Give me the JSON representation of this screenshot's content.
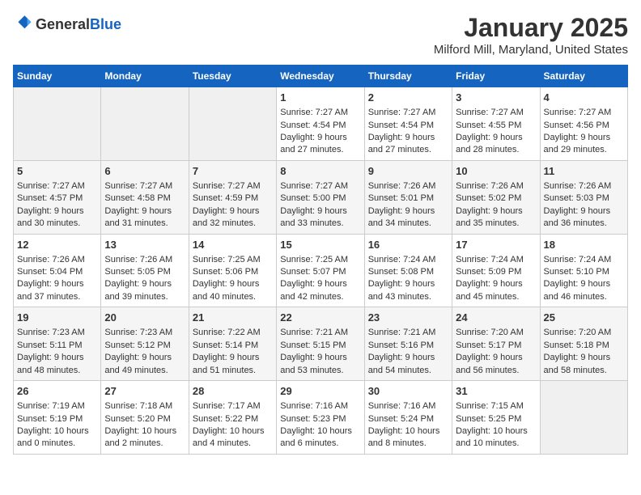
{
  "logo": {
    "text_general": "General",
    "text_blue": "Blue"
  },
  "title": "January 2025",
  "subtitle": "Milford Mill, Maryland, United States",
  "weekdays": [
    "Sunday",
    "Monday",
    "Tuesday",
    "Wednesday",
    "Thursday",
    "Friday",
    "Saturday"
  ],
  "weeks": [
    [
      {
        "day": "",
        "empty": true
      },
      {
        "day": "",
        "empty": true
      },
      {
        "day": "",
        "empty": true
      },
      {
        "day": "1",
        "sunrise": "7:27 AM",
        "sunset": "4:54 PM",
        "daylight": "9 hours and 27 minutes."
      },
      {
        "day": "2",
        "sunrise": "7:27 AM",
        "sunset": "4:54 PM",
        "daylight": "9 hours and 27 minutes."
      },
      {
        "day": "3",
        "sunrise": "7:27 AM",
        "sunset": "4:55 PM",
        "daylight": "9 hours and 28 minutes."
      },
      {
        "day": "4",
        "sunrise": "7:27 AM",
        "sunset": "4:56 PM",
        "daylight": "9 hours and 29 minutes."
      }
    ],
    [
      {
        "day": "5",
        "sunrise": "7:27 AM",
        "sunset": "4:57 PM",
        "daylight": "9 hours and 30 minutes."
      },
      {
        "day": "6",
        "sunrise": "7:27 AM",
        "sunset": "4:58 PM",
        "daylight": "9 hours and 31 minutes."
      },
      {
        "day": "7",
        "sunrise": "7:27 AM",
        "sunset": "4:59 PM",
        "daylight": "9 hours and 32 minutes."
      },
      {
        "day": "8",
        "sunrise": "7:27 AM",
        "sunset": "5:00 PM",
        "daylight": "9 hours and 33 minutes."
      },
      {
        "day": "9",
        "sunrise": "7:26 AM",
        "sunset": "5:01 PM",
        "daylight": "9 hours and 34 minutes."
      },
      {
        "day": "10",
        "sunrise": "7:26 AM",
        "sunset": "5:02 PM",
        "daylight": "9 hours and 35 minutes."
      },
      {
        "day": "11",
        "sunrise": "7:26 AM",
        "sunset": "5:03 PM",
        "daylight": "9 hours and 36 minutes."
      }
    ],
    [
      {
        "day": "12",
        "sunrise": "7:26 AM",
        "sunset": "5:04 PM",
        "daylight": "9 hours and 37 minutes."
      },
      {
        "day": "13",
        "sunrise": "7:26 AM",
        "sunset": "5:05 PM",
        "daylight": "9 hours and 39 minutes."
      },
      {
        "day": "14",
        "sunrise": "7:25 AM",
        "sunset": "5:06 PM",
        "daylight": "9 hours and 40 minutes."
      },
      {
        "day": "15",
        "sunrise": "7:25 AM",
        "sunset": "5:07 PM",
        "daylight": "9 hours and 42 minutes."
      },
      {
        "day": "16",
        "sunrise": "7:24 AM",
        "sunset": "5:08 PM",
        "daylight": "9 hours and 43 minutes."
      },
      {
        "day": "17",
        "sunrise": "7:24 AM",
        "sunset": "5:09 PM",
        "daylight": "9 hours and 45 minutes."
      },
      {
        "day": "18",
        "sunrise": "7:24 AM",
        "sunset": "5:10 PM",
        "daylight": "9 hours and 46 minutes."
      }
    ],
    [
      {
        "day": "19",
        "sunrise": "7:23 AM",
        "sunset": "5:11 PM",
        "daylight": "9 hours and 48 minutes."
      },
      {
        "day": "20",
        "sunrise": "7:23 AM",
        "sunset": "5:12 PM",
        "daylight": "9 hours and 49 minutes."
      },
      {
        "day": "21",
        "sunrise": "7:22 AM",
        "sunset": "5:14 PM",
        "daylight": "9 hours and 51 minutes."
      },
      {
        "day": "22",
        "sunrise": "7:21 AM",
        "sunset": "5:15 PM",
        "daylight": "9 hours and 53 minutes."
      },
      {
        "day": "23",
        "sunrise": "7:21 AM",
        "sunset": "5:16 PM",
        "daylight": "9 hours and 54 minutes."
      },
      {
        "day": "24",
        "sunrise": "7:20 AM",
        "sunset": "5:17 PM",
        "daylight": "9 hours and 56 minutes."
      },
      {
        "day": "25",
        "sunrise": "7:20 AM",
        "sunset": "5:18 PM",
        "daylight": "9 hours and 58 minutes."
      }
    ],
    [
      {
        "day": "26",
        "sunrise": "7:19 AM",
        "sunset": "5:19 PM",
        "daylight": "10 hours and 0 minutes."
      },
      {
        "day": "27",
        "sunrise": "7:18 AM",
        "sunset": "5:20 PM",
        "daylight": "10 hours and 2 minutes."
      },
      {
        "day": "28",
        "sunrise": "7:17 AM",
        "sunset": "5:22 PM",
        "daylight": "10 hours and 4 minutes."
      },
      {
        "day": "29",
        "sunrise": "7:16 AM",
        "sunset": "5:23 PM",
        "daylight": "10 hours and 6 minutes."
      },
      {
        "day": "30",
        "sunrise": "7:16 AM",
        "sunset": "5:24 PM",
        "daylight": "10 hours and 8 minutes."
      },
      {
        "day": "31",
        "sunrise": "7:15 AM",
        "sunset": "5:25 PM",
        "daylight": "10 hours and 10 minutes."
      },
      {
        "day": "",
        "empty": true
      }
    ]
  ],
  "labels": {
    "sunrise": "Sunrise:",
    "sunset": "Sunset:",
    "daylight": "Daylight:"
  }
}
